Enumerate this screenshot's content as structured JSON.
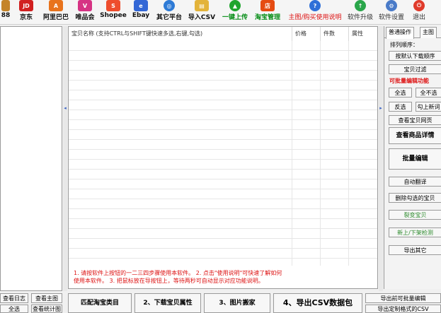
{
  "toolbar": {
    "items": [
      {
        "label": "88",
        "icon": "app-icon",
        "color": "#c4842b"
      },
      {
        "label": "京东",
        "icon": "jd-icon",
        "color": "#d12020"
      },
      {
        "label": "阿里巴巴",
        "icon": "alibaba-icon",
        "color": "#e8731c"
      },
      {
        "label": "唯品会",
        "icon": "vip-icon",
        "color": "#d63384"
      },
      {
        "label": "Shopee",
        "icon": "shopee-icon",
        "color": "#ee4d2d"
      },
      {
        "label": "Ebay",
        "icon": "ebay-icon",
        "color": "#3367d6"
      },
      {
        "label": "其它平台",
        "icon": "globe-icon",
        "color": "#2e7bd6"
      },
      {
        "label": "导入CSV",
        "icon": "folder-icon",
        "color": "#e3b33a"
      },
      {
        "label": "一键上传",
        "icon": "upload-icon",
        "color": "#1fa52e"
      },
      {
        "label": "淘宝管理",
        "icon": "shop-icon",
        "color": "#e54b12"
      },
      {
        "label": "主图/购买使用说明",
        "icon": "help-icon",
        "color": "#2f6fd8"
      },
      {
        "label": "软件升级",
        "icon": "upgrade-icon",
        "color": "#2aa64a"
      },
      {
        "label": "软件设置",
        "icon": "settings-icon",
        "color": "#4a7bc8"
      },
      {
        "label": "退出",
        "icon": "power-icon",
        "color": "#e03b2b"
      }
    ]
  },
  "grid": {
    "columns": [
      "宝贝名称 (支持CTRL与SHIFT键快速多选,右键,勾选)",
      "价格",
      "件数",
      "属性"
    ]
  },
  "notice": {
    "line1": "1. 请按软件上按钮的一二三四步骤使用本软件。 2. 点击\"使用说明\"可快速了解如何",
    "line2": "使用本软件。 3. 把鼠标放在导按钮上，等待两秒可自动显示对应功能说明。"
  },
  "right_panel": {
    "tab_general": "普通操作",
    "tab_main": "主图",
    "sort_label": "排列顺序：",
    "sort_button": "按默认下载顺序",
    "filter_button": "宝贝过滤",
    "batch_label": "可批量编辑功能",
    "select_all": "全选",
    "select_none": "全不选",
    "invert": "反选",
    "check_new": "勾上新词",
    "view_pages": "查看宝贝网页",
    "view_details": "查看商品详情",
    "batch_edit": "批量编辑",
    "auto_translate": "自动翻译",
    "delete_checked": "删除勾选的宝贝",
    "split_items": "裂变宝贝",
    "shelf_check": "新上/下架检测",
    "export_other": "导出其它"
  },
  "bottom": {
    "view_log": "查看日志",
    "view_home": "查看主图",
    "all": "全选",
    "view_stats": "查看统计图",
    "step1": "匹配淘宝类目",
    "step2": "2、下载宝贝属性",
    "step3": "3、图片搬家",
    "step4": "4、导出CSV数据包",
    "batch_export": "导出前可批量编辑",
    "export_custom": "导出定制格式的CSV"
  }
}
